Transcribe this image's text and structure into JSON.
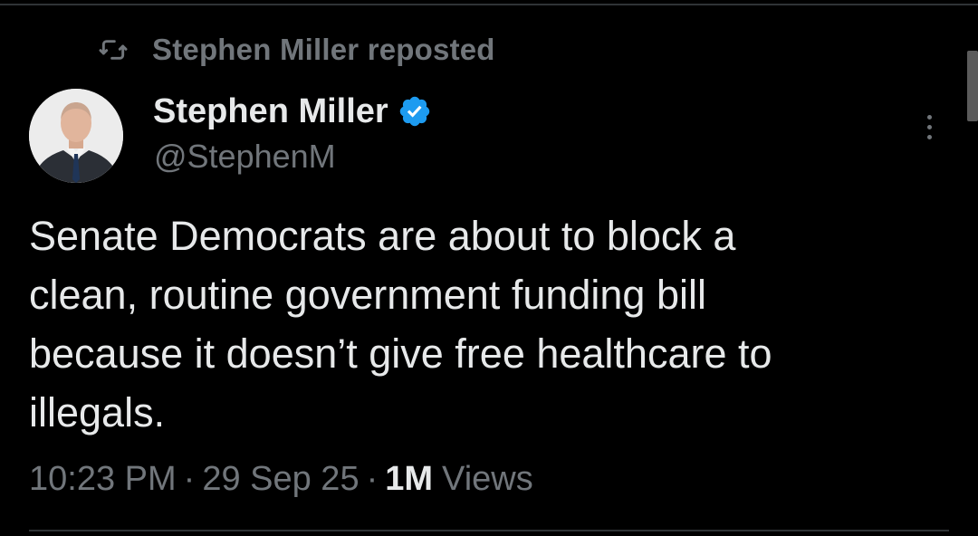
{
  "repost": {
    "icon": "repost-icon",
    "text": "Stephen Miller reposted"
  },
  "author": {
    "display_name": "Stephen Miller",
    "handle": "@StephenM",
    "verified_icon": "verified-badge-icon",
    "verified_color": "#1d9bf0"
  },
  "tweet": {
    "text": "Senate Democrats are about to block a\nclean, routine government funding bill\nbecause it doesn’t give free healthcare to\nillegals."
  },
  "meta": {
    "time": "10:23 PM",
    "separator": "·",
    "date": "29 Sep 25",
    "views_count": "1M",
    "views_label": "Views"
  },
  "colors": {
    "background": "#000000",
    "primary_text": "#e7e9ea",
    "secondary_text": "#71767b",
    "divider": "#2f3336"
  }
}
